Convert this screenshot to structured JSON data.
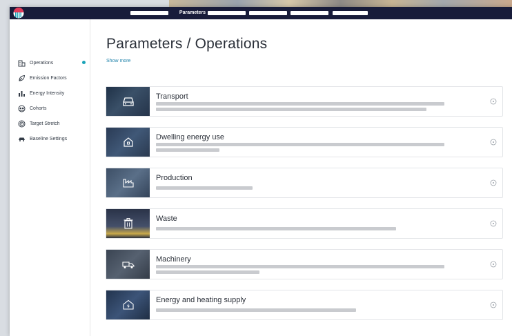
{
  "topbar": {
    "active_tab": "Parameters"
  },
  "sidebar": {
    "items": [
      {
        "label": "Operations",
        "icon": "building-icon",
        "active": true
      },
      {
        "label": "Emission Factors",
        "icon": "leaf-icon",
        "active": false
      },
      {
        "label": "Energy Intensity",
        "icon": "bar-chart-icon",
        "active": false
      },
      {
        "label": "Cohorts",
        "icon": "cohorts-icon",
        "active": false
      },
      {
        "label": "Target Stretch",
        "icon": "target-icon",
        "active": false
      },
      {
        "label": "Baseline Settings",
        "icon": "car-icon",
        "active": false
      }
    ],
    "accent": "#1aa3b8"
  },
  "main": {
    "title": "Parameters / Operations",
    "show_more": "Show more"
  },
  "cards": [
    {
      "title": "Transport",
      "icon": "car-icon"
    },
    {
      "title": "Dwelling energy use",
      "icon": "house-icon"
    },
    {
      "title": "Production",
      "icon": "factory-icon"
    },
    {
      "title": "Waste",
      "icon": "trash-icon"
    },
    {
      "title": "Machinery",
      "icon": "truck-icon"
    },
    {
      "title": "Energy and heating supply",
      "icon": "power-house-icon"
    }
  ],
  "colors": {
    "topbar": "#181c3a",
    "thumb": "#2c3b55",
    "placeholder_line": "#c9cbcf",
    "link": "#1a7fa8"
  }
}
